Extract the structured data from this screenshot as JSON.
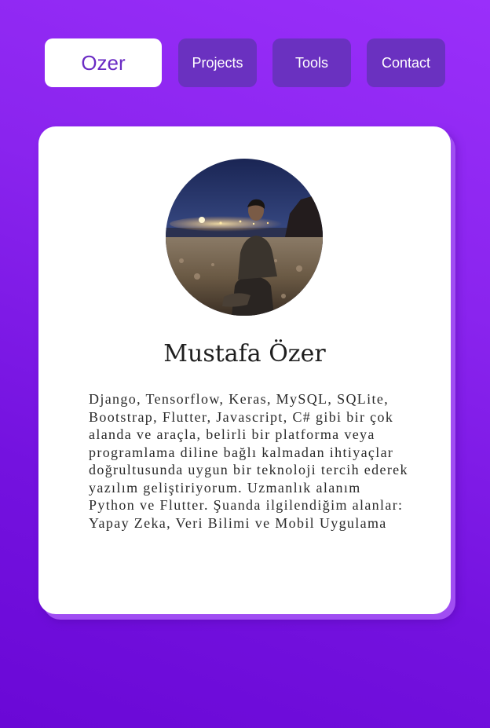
{
  "nav": {
    "home_label": "Ozer",
    "items": [
      {
        "label": "Projects"
      },
      {
        "label": "Tools"
      },
      {
        "label": "Contact"
      }
    ]
  },
  "profile": {
    "name": "Mustafa Özer",
    "bio": "Django, Tensorflow, Keras, MySQL, SQLite, Bootstrap, Flutter, Javascript, C# gibi bir çok alanda ve araçla, belirli bir platforma veya programlama diline bağlı kalmadan ihtiyaçlar doğrultusunda uygun bir teknoloji tercih ederek yazılım geliştiriyorum. Uzmanlık alanım Python ve Flutter. Şuanda ilgilendiğim alanlar: Yapay Zeka, Veri Bilimi ve Mobil Uygulama"
  },
  "colors": {
    "background_top": "#9a2ffa",
    "background_bottom": "#6a08d6",
    "nav_button": "#6a31c0",
    "home_text": "#6a2bc4",
    "card_shadow": "#a04ef2"
  }
}
